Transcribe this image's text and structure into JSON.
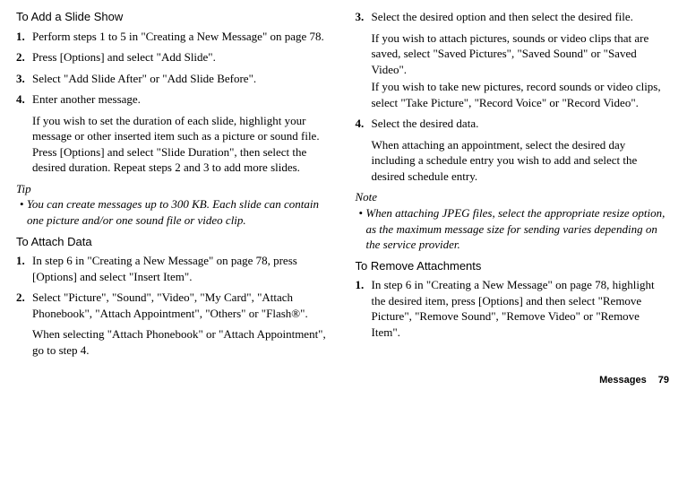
{
  "left": {
    "h1": "To Add a Slide Show",
    "s1": [
      "Perform steps 1 to 5 in \"Creating a New Message\" on page 78.",
      "Press [Options] and select \"Add Slide\".",
      "Select \"Add Slide After\" or \"Add Slide Before\".",
      "Enter another message."
    ],
    "s1_sub": "If you wish to set the duration of each slide, highlight your message or other inserted item such as a picture or sound file. Press [Options] and select \"Slide Duration\", then select the desired duration. Repeat steps 2 and 3 to add more slides.",
    "tip_label": "Tip",
    "tip_body": "You can create messages up to 300 KB. Each slide can contain one picture and/or one sound file or video clip.",
    "h2": "To Attach Data",
    "s2": [
      "In step 6 in \"Creating a New Message\" on page 78, press [Options] and select \"Insert Item\".",
      "Select \"Picture\", \"Sound\", \"Video\", \"My Card\", \"Attach Phonebook\", \"Attach Appointment\", \"Others\" or \"Flash®\"."
    ],
    "s2_sub": "When selecting \"Attach Phonebook\" or \"Attach Appointment\", go to step 4."
  },
  "right": {
    "s3_start": 3,
    "s3": [
      "Select the desired option and then select the desired file.",
      "Select the desired data."
    ],
    "s3_sub1a": "If you wish to attach pictures, sounds or video clips that are saved, select \"Saved Pictures\", \"Saved Sound\" or \"Saved Video\".",
    "s3_sub1b": "If you wish to take new pictures, record sounds or video clips, select \"Take Picture\", \"Record Voice\" or \"Record Video\".",
    "s3_sub2": "When attaching an appointment, select the desired day including a schedule entry you wish to add and select the desired schedule entry.",
    "note_label": "Note",
    "note_body": "When attaching JPEG files, select the appropriate resize option, as the maximum message size for sending varies depending on the service provider.",
    "h3": "To Remove Attachments",
    "s4": [
      "In step 6 in \"Creating a New Message\" on page 78, highlight the desired item, press [Options] and then select \"Remove Picture\", \"Remove Sound\", \"Remove Video\" or \"Remove Item\"."
    ]
  },
  "footer": {
    "label": "Messages",
    "page": "79"
  }
}
